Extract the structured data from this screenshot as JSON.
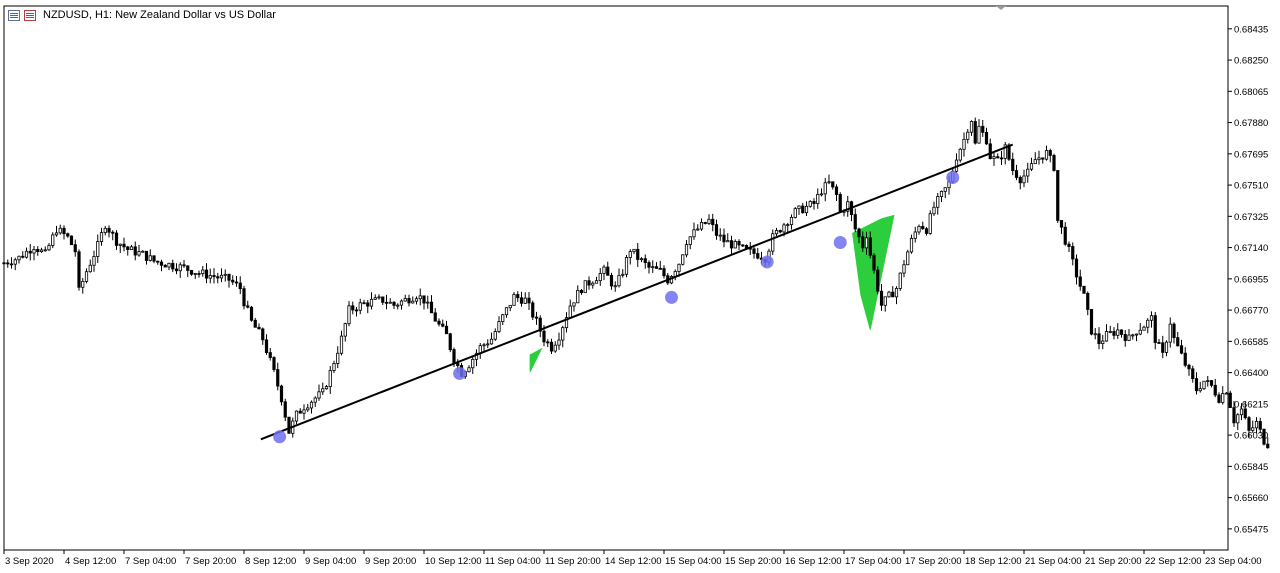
{
  "header": {
    "symbol_line": "NZDUSD, H1:  New Zealand Dollar vs US Dollar",
    "icons": [
      "chart-window-icon",
      "chart-window-icon-alt"
    ]
  },
  "colors": {
    "background": "#ffffff",
    "candle": "#000000",
    "trendline": "#000000",
    "touch_point": "#6e6ef0",
    "fill": "#22cc33"
  },
  "chart_data": {
    "type": "candlestick",
    "symbol": "NZDUSD",
    "timeframe": "H1",
    "y_ticks": [
      "0.68435",
      "0.68250",
      "0.68065",
      "0.67880",
      "0.67695",
      "0.67510",
      "0.67325",
      "0.67140",
      "0.66955",
      "0.66770",
      "0.66585",
      "0.66400",
      "0.66215",
      "0.66030",
      "0.65845",
      "0.65660",
      "0.65475"
    ],
    "ylim": [
      0.6535,
      0.6857
    ],
    "x_ticks": [
      "3 Sep 2020",
      "4 Sep 12:00",
      "7 Sep 04:00",
      "7 Sep 20:00",
      "8 Sep 12:00",
      "9 Sep 04:00",
      "9 Sep 20:00",
      "10 Sep 12:00",
      "11 Sep 04:00",
      "11 Sep 20:00",
      "14 Sep 12:00",
      "15 Sep 04:00",
      "15 Sep 20:00",
      "16 Sep 12:00",
      "17 Sep 04:00",
      "17 Sep 20:00",
      "18 Sep 12:00",
      "21 Sep 04:00",
      "21 Sep 20:00",
      "22 Sep 12:00",
      "23 Sep 04:00"
    ],
    "hours_per_tick": 16,
    "close_path": [
      [
        0,
        0.6705
      ],
      [
        4,
        0.6708
      ],
      [
        8,
        0.6715
      ],
      [
        11,
        0.671
      ],
      [
        14,
        0.6725
      ],
      [
        17,
        0.672
      ],
      [
        19,
        0.6712
      ],
      [
        20,
        0.6688
      ],
      [
        22,
        0.67
      ],
      [
        25,
        0.6715
      ],
      [
        27,
        0.6728
      ],
      [
        30,
        0.6718
      ],
      [
        33,
        0.6713
      ],
      [
        37,
        0.671
      ],
      [
        40,
        0.6706
      ],
      [
        44,
        0.6704
      ],
      [
        48,
        0.6702
      ],
      [
        52,
        0.6699
      ],
      [
        56,
        0.6697
      ],
      [
        60,
        0.6695
      ],
      [
        63,
        0.669
      ],
      [
        64,
        0.6682
      ],
      [
        66,
        0.667
      ],
      [
        69,
        0.666
      ],
      [
        72,
        0.664
      ],
      [
        74,
        0.6625
      ],
      [
        76,
        0.6605
      ],
      [
        78,
        0.6615
      ],
      [
        80,
        0.662
      ],
      [
        83,
        0.6625
      ],
      [
        85,
        0.6628
      ],
      [
        87,
        0.664
      ],
      [
        90,
        0.666
      ],
      [
        92,
        0.6677
      ],
      [
        95,
        0.668
      ],
      [
        98,
        0.6682
      ],
      [
        101,
        0.6683
      ],
      [
        104,
        0.668
      ],
      [
        107,
        0.6683
      ],
      [
        110,
        0.6686
      ],
      [
        112,
        0.6683
      ],
      [
        114,
        0.6675
      ],
      [
        116,
        0.6668
      ],
      [
        118,
        0.6662
      ],
      [
        120,
        0.6648
      ],
      [
        122,
        0.664
      ],
      [
        124,
        0.6645
      ],
      [
        127,
        0.6655
      ],
      [
        130,
        0.666
      ],
      [
        133,
        0.6673
      ],
      [
        136,
        0.6685
      ],
      [
        139,
        0.6683
      ],
      [
        142,
        0.667
      ],
      [
        144,
        0.666
      ],
      [
        146,
        0.6655
      ],
      [
        148,
        0.6662
      ],
      [
        151,
        0.668
      ],
      [
        154,
        0.669
      ],
      [
        157,
        0.6695
      ],
      [
        160,
        0.67
      ],
      [
        163,
        0.669
      ],
      [
        165,
        0.67
      ],
      [
        167,
        0.6713
      ],
      [
        169,
        0.6708
      ],
      [
        172,
        0.6702
      ],
      [
        175,
        0.67
      ],
      [
        177,
        0.6695
      ],
      [
        180,
        0.6705
      ],
      [
        182,
        0.6718
      ],
      [
        185,
        0.6725
      ],
      [
        188,
        0.673
      ],
      [
        190,
        0.6722
      ],
      [
        192,
        0.6718
      ],
      [
        195,
        0.6715
      ],
      [
        198,
        0.6712
      ],
      [
        201,
        0.671
      ],
      [
        203,
        0.6708
      ],
      [
        205,
        0.672
      ],
      [
        208,
        0.6728
      ],
      [
        211,
        0.6735
      ],
      [
        214,
        0.6738
      ],
      [
        216,
        0.674
      ],
      [
        218,
        0.6748
      ],
      [
        220,
        0.6752
      ],
      [
        222,
        0.6745
      ],
      [
        223,
        0.6735
      ],
      [
        225,
        0.674
      ],
      [
        227,
        0.6725
      ],
      [
        229,
        0.6715
      ],
      [
        230,
        0.6722
      ],
      [
        231,
        0.671
      ],
      [
        232,
        0.67
      ],
      [
        233,
        0.669
      ],
      [
        234,
        0.668
      ],
      [
        236,
        0.6685
      ],
      [
        238,
        0.669
      ],
      [
        240,
        0.6705
      ],
      [
        242,
        0.6718
      ],
      [
        244,
        0.6728
      ],
      [
        246,
        0.6725
      ],
      [
        248,
        0.6738
      ],
      [
        250,
        0.6745
      ],
      [
        252,
        0.6752
      ],
      [
        254,
        0.6768
      ],
      [
        256,
        0.6778
      ],
      [
        257,
        0.6785
      ],
      [
        258,
        0.679
      ],
      [
        259,
        0.6775
      ],
      [
        260,
        0.6785
      ],
      [
        262,
        0.6778
      ],
      [
        263,
        0.6768
      ],
      [
        265,
        0.6765
      ],
      [
        267,
        0.6773
      ],
      [
        269,
        0.676
      ],
      [
        271,
        0.6755
      ],
      [
        273,
        0.6758
      ],
      [
        275,
        0.6766
      ],
      [
        278,
        0.677
      ],
      [
        280,
        0.6762
      ],
      [
        281,
        0.673
      ],
      [
        282,
        0.6725
      ],
      [
        284,
        0.6712
      ],
      [
        286,
        0.6698
      ],
      [
        288,
        0.6685
      ],
      [
        290,
        0.6665
      ],
      [
        292,
        0.6658
      ],
      [
        294,
        0.6662
      ],
      [
        297,
        0.6665
      ],
      [
        300,
        0.666
      ],
      [
        302,
        0.6665
      ],
      [
        304,
        0.6668
      ],
      [
        306,
        0.6672
      ],
      [
        307,
        0.666
      ],
      [
        309,
        0.665
      ],
      [
        311,
        0.667
      ],
      [
        312,
        0.666
      ],
      [
        314,
        0.665
      ],
      [
        316,
        0.664
      ],
      [
        318,
        0.663
      ],
      [
        320,
        0.6635
      ],
      [
        322,
        0.6632
      ],
      [
        324,
        0.6625
      ],
      [
        326,
        0.663
      ],
      [
        328,
        0.6612
      ],
      [
        330,
        0.6618
      ],
      [
        332,
        0.6605
      ],
      [
        334,
        0.661
      ],
      [
        336,
        0.66
      ],
      [
        337,
        0.6598
      ]
    ],
    "trendline": {
      "start": {
        "x_hour": 68.5,
        "price": 0.66005
      },
      "end": {
        "x_hour": 269.0,
        "price": 0.6775
      }
    },
    "touch_points": [
      {
        "x_hour": 73.5,
        "price": 0.6602
      },
      {
        "x_hour": 121.5,
        "price": 0.66395
      },
      {
        "x_hour": 178.0,
        "price": 0.66845
      },
      {
        "x_hour": 203.5,
        "price": 0.67055
      },
      {
        "x_hour": 223.0,
        "price": 0.6717
      },
      {
        "x_hour": 253.0,
        "price": 0.67555
      }
    ],
    "filled_regions": [
      {
        "points": [
          [
            140.3,
            0.66505
          ],
          [
            140.3,
            0.66405
          ],
          [
            143.3,
            0.6654
          ]
        ]
      },
      {
        "points": [
          [
            226.3,
            0.67225
          ],
          [
            228.5,
            0.6686
          ],
          [
            231.0,
            0.66655
          ],
          [
            237.3,
            0.6733
          ],
          [
            234.0,
            0.6731
          ]
        ]
      }
    ]
  }
}
